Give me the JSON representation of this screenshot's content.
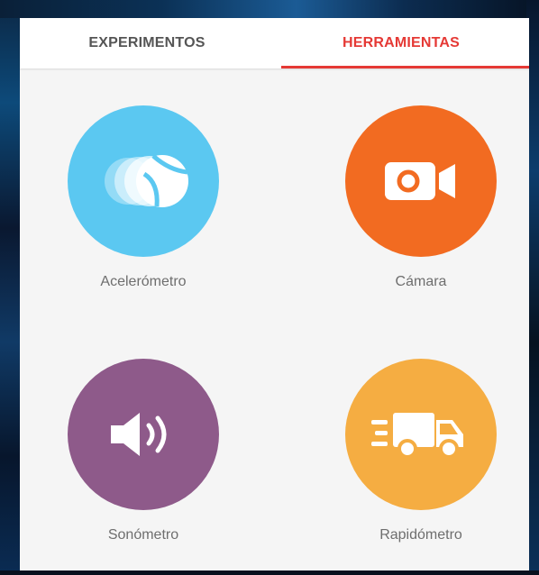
{
  "tabs": [
    {
      "label": "EXPERIMENTOS",
      "active": false
    },
    {
      "label": "HERRAMIENTAS",
      "active": true
    }
  ],
  "accent_color": "#e53935",
  "tools": [
    {
      "label": "Acelerómetro",
      "icon": "ball-motion-icon",
      "color": "#5bc8f1"
    },
    {
      "label": "Cámara",
      "icon": "video-camera-icon",
      "color": "#f26b21"
    },
    {
      "label": "Sonómetro",
      "icon": "speaker-icon",
      "color": "#8e5a8a"
    },
    {
      "label": "Rapidómetro",
      "icon": "fast-truck-icon",
      "color": "#f5ad42"
    }
  ]
}
